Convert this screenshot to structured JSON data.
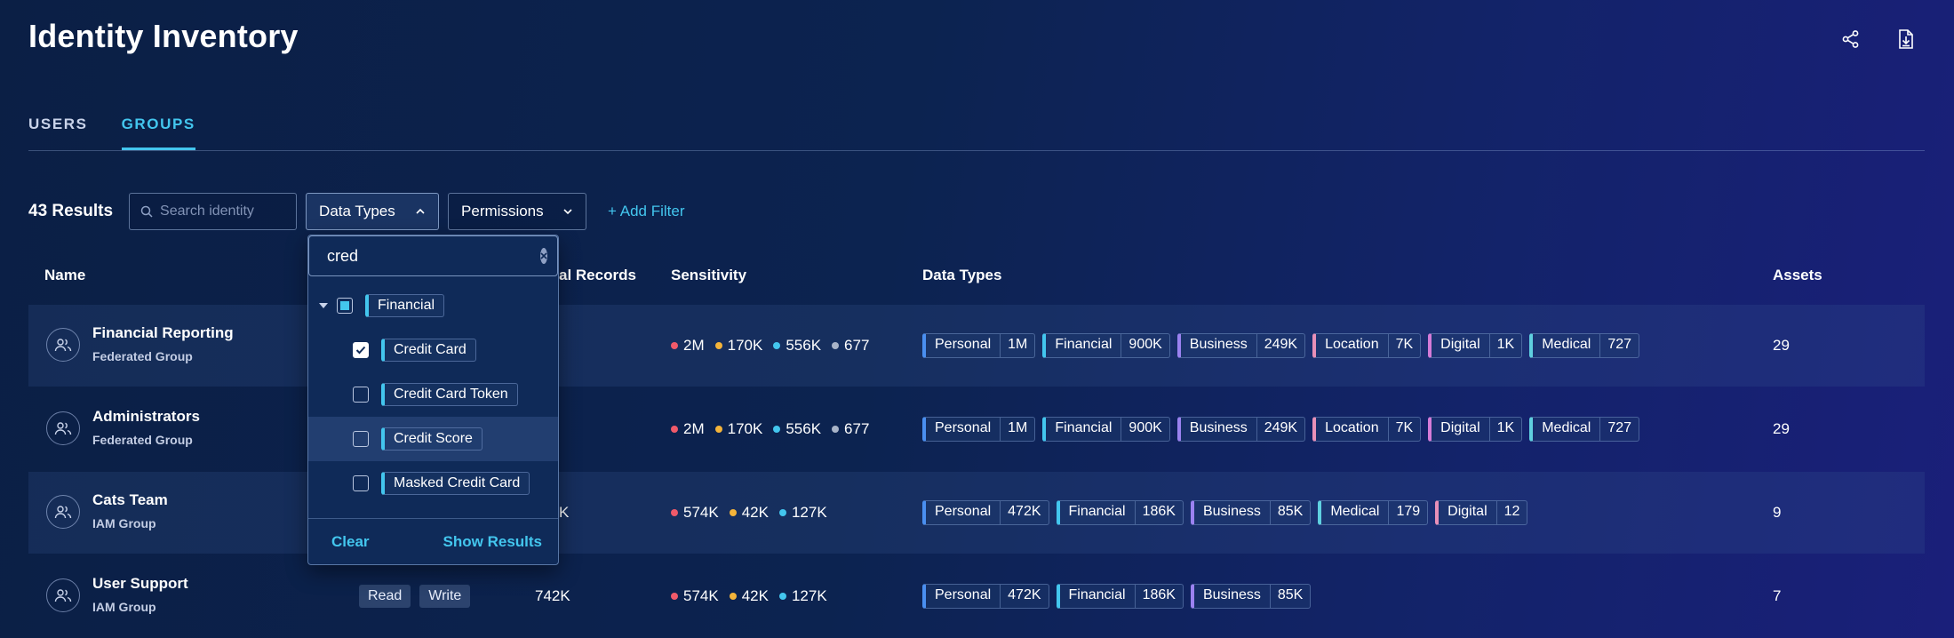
{
  "header": {
    "title": "Identity Inventory",
    "icons": [
      "share-icon",
      "export-icon"
    ]
  },
  "tabs": [
    {
      "label": "USERS",
      "active": false
    },
    {
      "label": "GROUPS",
      "active": true
    }
  ],
  "filters": {
    "results": "43 Results",
    "search_placeholder": "Search identity",
    "data_types_label": "Data Types",
    "permissions_label": "Permissions",
    "add_filter": "+ Add Filter"
  },
  "columns": {
    "name": "Name",
    "records": "al Records",
    "sensitivity": "Sensitivity",
    "data_types": "Data Types",
    "assets": "Assets"
  },
  "sensitivity_colors": {
    "critical": "#f05a6a",
    "high": "#f4b43a",
    "medium": "#43c6ee",
    "low": "#a9b4c8"
  },
  "rows": [
    {
      "name": "Financial Reporting",
      "type": "Federated Group",
      "permissions": [],
      "records": "",
      "sensitivity": [
        "2M",
        "170K",
        "556K",
        "677"
      ],
      "data_types": [
        {
          "label": "Personal",
          "value": "1M",
          "color": "#4a8ff0"
        },
        {
          "label": "Financial",
          "value": "900K",
          "color": "#43c6ee"
        },
        {
          "label": "Business",
          "value": "249K",
          "color": "#9b82f0"
        },
        {
          "label": "Location",
          "value": "7K",
          "color": "#e890b8"
        },
        {
          "label": "Digital",
          "value": "1K",
          "color": "#d57bd8"
        },
        {
          "label": "Medical",
          "value": "727",
          "color": "#5fd0e0"
        }
      ],
      "assets": "29"
    },
    {
      "name": "Administrators",
      "type": "Federated Group",
      "permissions": [],
      "records": "",
      "sensitivity": [
        "2M",
        "170K",
        "556K",
        "677"
      ],
      "data_types": [
        {
          "label": "Personal",
          "value": "1M",
          "color": "#4a8ff0"
        },
        {
          "label": "Financial",
          "value": "900K",
          "color": "#43c6ee"
        },
        {
          "label": "Business",
          "value": "249K",
          "color": "#9b82f0"
        },
        {
          "label": "Location",
          "value": "7K",
          "color": "#e890b8"
        },
        {
          "label": "Digital",
          "value": "1K",
          "color": "#d57bd8"
        },
        {
          "label": "Medical",
          "value": "727",
          "color": "#5fd0e0"
        }
      ],
      "assets": "29"
    },
    {
      "name": "Cats Team",
      "type": "IAM Group",
      "permissions": [],
      "records": "K",
      "sensitivity": [
        "574K",
        "42K",
        "127K"
      ],
      "data_types": [
        {
          "label": "Personal",
          "value": "472K",
          "color": "#4a8ff0"
        },
        {
          "label": "Financial",
          "value": "186K",
          "color": "#43c6ee"
        },
        {
          "label": "Business",
          "value": "85K",
          "color": "#9b82f0"
        },
        {
          "label": "Medical",
          "value": "179",
          "color": "#5fd0e0"
        },
        {
          "label": "Digital",
          "value": "12",
          "color": "#e890b8"
        }
      ],
      "assets": "9"
    },
    {
      "name": "User Support",
      "type": "IAM Group",
      "permissions": [
        "Read",
        "Write"
      ],
      "records": "742K",
      "sensitivity": [
        "574K",
        "42K",
        "127K"
      ],
      "data_types": [
        {
          "label": "Personal",
          "value": "472K",
          "color": "#4a8ff0"
        },
        {
          "label": "Financial",
          "value": "186K",
          "color": "#43c6ee"
        },
        {
          "label": "Business",
          "value": "85K",
          "color": "#9b82f0"
        }
      ],
      "assets": "7"
    }
  ],
  "dropdown": {
    "search_value": "cred",
    "group": {
      "label": "Financial",
      "state": "partial"
    },
    "options": [
      {
        "label": "Credit Card",
        "checked": true
      },
      {
        "label": "Credit Card Token",
        "checked": false
      },
      {
        "label": "Credit Score",
        "checked": false
      },
      {
        "label": "Masked Credit Card",
        "checked": false
      }
    ],
    "clear_label": "Clear",
    "show_label": "Show Results"
  }
}
